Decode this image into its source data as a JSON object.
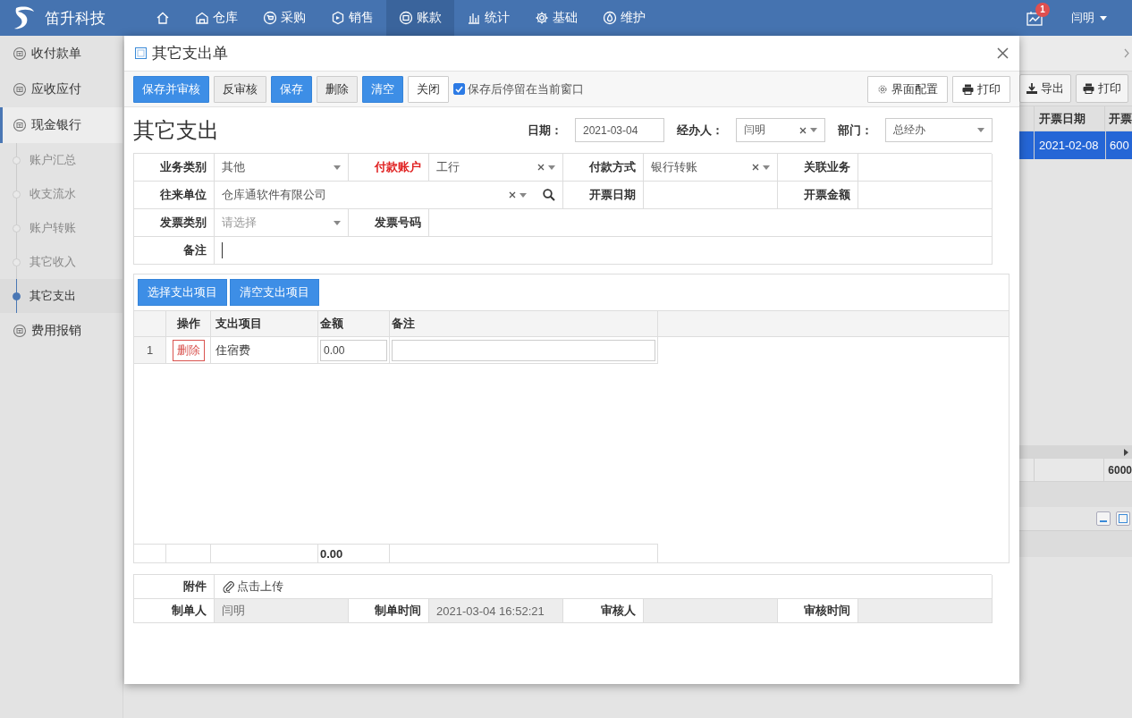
{
  "app": {
    "name": "笛升科技"
  },
  "nav": [
    {
      "selected": false
    },
    {
      "label": "仓库",
      "selected": false
    },
    {
      "label": "采购",
      "selected": false
    },
    {
      "label": "销售",
      "selected": false
    },
    {
      "label": "账款",
      "selected": true
    },
    {
      "label": "统计",
      "selected": false
    },
    {
      "label": "基础",
      "selected": false
    },
    {
      "label": "维护",
      "selected": false
    }
  ],
  "user": {
    "notifications": "1",
    "name": "闫明"
  },
  "sidebar": {
    "items": [
      {
        "label": "收付款单"
      },
      {
        "label": "应收应付"
      },
      {
        "label": "现金银行",
        "expanded": true,
        "children": [
          {
            "label": "账户汇总",
            "selected": false
          },
          {
            "label": "收支流水",
            "selected": false
          },
          {
            "label": "账户转账",
            "selected": false
          },
          {
            "label": "其它收入",
            "selected": false
          },
          {
            "label": "其它支出",
            "selected": true
          }
        ]
      },
      {
        "label": "费用报销"
      }
    ]
  },
  "background_panel": {
    "buttons": [
      "导出",
      "打印"
    ],
    "table": {
      "columns": [
        "开票日期",
        "开票"
      ],
      "rows": [
        {
          "cells": [
            "2021-02-08",
            "600"
          ],
          "selected": true
        }
      ],
      "totals": [
        "6000"
      ]
    }
  },
  "dialog": {
    "title": "其它支出单",
    "toolbar": {
      "buttons": [
        {
          "label": "保存并审核",
          "kind": "primary"
        },
        {
          "label": "反审核",
          "kind": "default"
        },
        {
          "label": "保存",
          "kind": "primary"
        },
        {
          "label": "删除",
          "kind": "default"
        },
        {
          "label": "清空",
          "kind": "primary"
        },
        {
          "label": "关闭",
          "kind": "plain"
        }
      ],
      "stay_option": {
        "label": "保存后停留在当前窗口",
        "checked": true
      },
      "right_buttons": [
        "界面配置",
        "打印"
      ]
    },
    "heading": "其它支出",
    "header_fields": [
      {
        "label": "日期：",
        "value": "2021-03-04",
        "kind": "date"
      },
      {
        "label": "经办人：",
        "value": "闫明",
        "kind": "select",
        "clearable": true
      },
      {
        "label": "部门：",
        "value": "总经办",
        "kind": "select",
        "clearable": false
      }
    ],
    "form": {
      "rows": [
        [
          {
            "kind": "label",
            "text": "业务类别",
            "required": false
          },
          {
            "kind": "select",
            "value": "其他",
            "clearable": false
          },
          {
            "kind": "label",
            "text": "付款账户",
            "required": true
          },
          {
            "kind": "select",
            "value": "工行",
            "clearable": true
          },
          {
            "kind": "label",
            "text": "付款方式",
            "required": false
          },
          {
            "kind": "select",
            "value": "银行转账",
            "clearable": true
          },
          {
            "kind": "label",
            "text": "关联业务",
            "required": false
          },
          {
            "kind": "text"
          }
        ],
        [
          {
            "kind": "label",
            "text": "往来单位",
            "required": false
          },
          {
            "kind": "select",
            "value": "仓库通软件有限公司",
            "clearable": true,
            "searchable": true
          },
          "",
          "",
          {
            "kind": "label",
            "text": "开票日期",
            "required": false
          },
          {
            "kind": "text"
          },
          {
            "kind": "label",
            "text": "开票金额",
            "required": false
          },
          {
            "kind": "text"
          }
        ],
        [
          {
            "kind": "label",
            "text": "发票类别",
            "required": false
          },
          {
            "kind": "select",
            "placeholder": "请选择",
            "clearable": false
          },
          {
            "kind": "label",
            "text": "发票号码",
            "required": false
          },
          {
            "kind": "text"
          },
          "",
          "",
          "",
          ""
        ],
        [
          {
            "kind": "label",
            "text": "备注",
            "required": false
          },
          {
            "kind": "text",
            "focused": true
          },
          "",
          "",
          "",
          "",
          "",
          ""
        ]
      ]
    },
    "items": {
      "buttons": [
        "选择支出项目",
        "清空支出项目"
      ],
      "columns": [
        "操作",
        "支出项目",
        "金额",
        "备注"
      ],
      "rows": [
        {
          "index": "1",
          "action": "删除",
          "item": "住宿费",
          "amount": "0.00"
        }
      ],
      "totals": {
        "amount": "0.00"
      }
    },
    "attachment": {
      "label": "附件",
      "link": "点击上传"
    },
    "audit": [
      {
        "label": "制单人",
        "value": "闫明"
      },
      {
        "label": "制单时间",
        "value": "2021-03-04 16:52:21"
      },
      {
        "label": "审核人"
      },
      {
        "label": "审核时间"
      }
    ]
  }
}
